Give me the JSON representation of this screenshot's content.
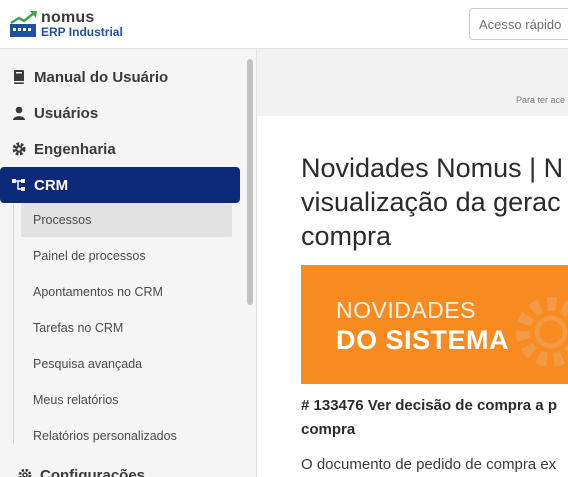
{
  "header": {
    "logo": {
      "brand": "nomus",
      "product": "ERP Industrial"
    },
    "quick_search": {
      "placeholder": "Acesso rápido"
    }
  },
  "sidebar": {
    "items": [
      {
        "label": "Manual do Usuário",
        "icon": "book-icon"
      },
      {
        "label": "Usuários",
        "icon": "user-icon"
      },
      {
        "label": "Engenharia",
        "icon": "gear-icon"
      },
      {
        "label": "CRM",
        "icon": "sitemap-icon",
        "active": true
      },
      {
        "label": "Configurações",
        "icon": "gears-icon"
      }
    ],
    "crm_subitems": [
      {
        "label": "Processos",
        "selected": true
      },
      {
        "label": "Painel de processos"
      },
      {
        "label": "Apontamentos no CRM"
      },
      {
        "label": "Tarefas no CRM"
      },
      {
        "label": "Pesquisa avançada"
      },
      {
        "label": "Meus relatórios"
      },
      {
        "label": "Relatórios personalizados"
      }
    ],
    "active_color": "#0d2a7a"
  },
  "main": {
    "top_note": "Para ter ace",
    "article": {
      "title": "Novidades Nomus | N visualização da gerac de compra",
      "banner": {
        "line1": "NOVIDADES",
        "line2": "DO SISTEMA",
        "color": "#f78b1f"
      },
      "item_heading": "# 133476 Ver decisão de compra a p compra",
      "item_text": "O documento de pedido de compra ex"
    }
  }
}
